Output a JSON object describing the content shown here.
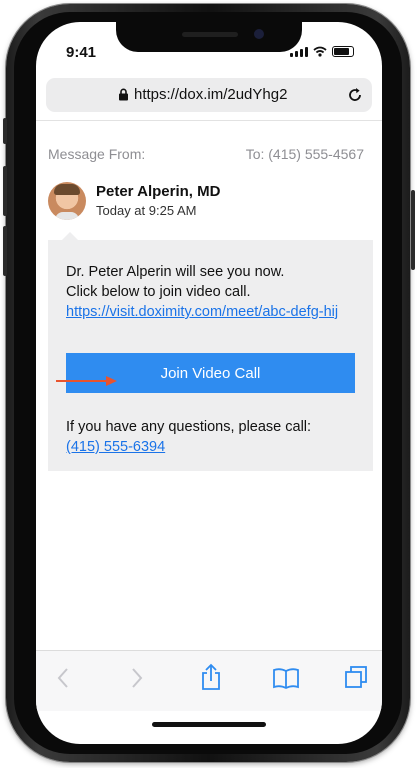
{
  "status_bar": {
    "time": "9:41"
  },
  "browser": {
    "url": "https://dox.im/2udYhg2"
  },
  "message": {
    "from_label": "Message From:",
    "to_label": "To: (415) 555-4567",
    "sender_name": "Peter Alperin, MD",
    "sender_time": "Today at 9:25 AM",
    "body_line1": "Dr. Peter Alperin will see you now.",
    "body_line2": "Click below to join video call.",
    "link": "https://visit.doximity.com/meet/abc-defg-hij",
    "join_button": "Join Video Call",
    "questions_text": "If you have any questions, please call:",
    "phone_link": "(415) 555-6394"
  },
  "colors": {
    "accent": "#2f8cf0",
    "link": "#1a73e8",
    "bubble": "#eeeeef",
    "arrow": "#e8542e"
  },
  "toolbar": {
    "icons": [
      "back-icon",
      "forward-icon",
      "share-icon",
      "bookmarks-icon",
      "tabs-icon"
    ]
  }
}
